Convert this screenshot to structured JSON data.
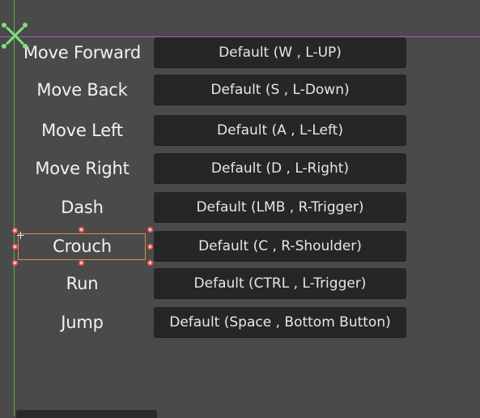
{
  "bindings": [
    {
      "action": "Move Forward",
      "binding": "Default (W , L-UP)"
    },
    {
      "action": "Move Back",
      "binding": "Default (S , L-Down)"
    },
    {
      "action": "Move Left",
      "binding": "Default (A , L-Left)"
    },
    {
      "action": "Move Right",
      "binding": "Default (D , L-Right)"
    },
    {
      "action": "Dash",
      "binding": "Default (LMB , R-Trigger)"
    },
    {
      "action": "Crouch",
      "binding": "Default (C , R-Shoulder)"
    },
    {
      "action": "Run",
      "binding": "Default (CTRL , L-Trigger)"
    },
    {
      "action": "Jump",
      "binding": "Default (Space , Bottom Button)"
    }
  ],
  "editor": {
    "selected_item": "Crouch",
    "origin_icon": "origin-cross-icon",
    "guide_colors": {
      "vertical": "#6fbf4a",
      "horizontal": "#c85ad0",
      "selection": "#d98b4f",
      "handle": "#ee5d55"
    }
  }
}
